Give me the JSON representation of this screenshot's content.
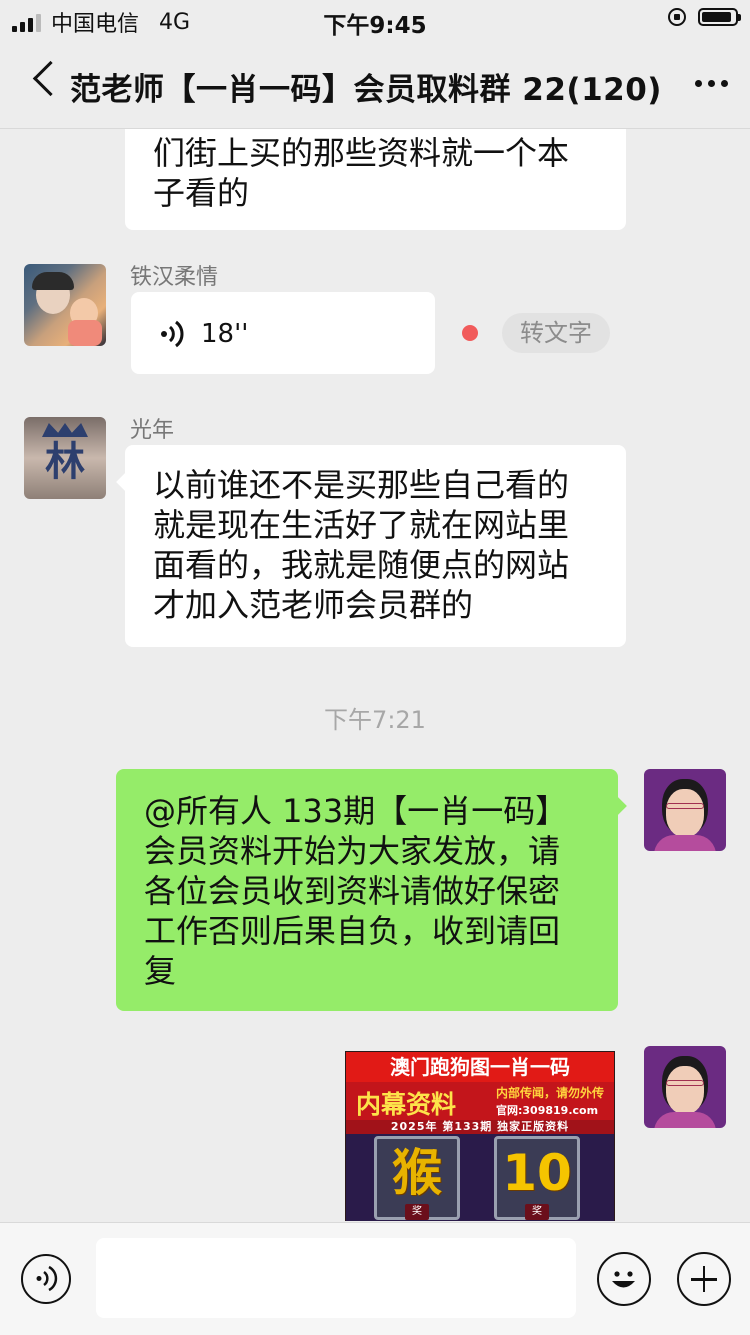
{
  "status_bar": {
    "carrier": "中国电信",
    "network": "4G",
    "time": "下午9:45",
    "battery_level": 0.9
  },
  "nav": {
    "title": "范老师【一肖一码】会员取料群 22(120)",
    "back_icon": "chevron-left-icon",
    "more_icon": "more-dots-icon"
  },
  "messages": {
    "m1_text_line1": "们街上买的那些资料就一个本",
    "m1_text_line2": "子看的",
    "m2_sender": "铁汉柔情",
    "m2_voice_length": "18''",
    "m2_convert_label": "转文字",
    "m3_sender": "光年",
    "m3_lines": [
      "以前谁还不是买那些自己看的",
      "就是现在生活好了就在网站里",
      "面看的，我就是随便点的网站",
      "才加入范老师会员群的"
    ],
    "timestamp": "下午7:21",
    "m4_lines": [
      "@所有人 133期【一肖一码】",
      "会员资料开始为大家发放，请",
      "各位会员收到资料请做好保密",
      "工作否则后果自负，收到请回",
      "复"
    ],
    "promo": {
      "title": "澳门跑狗图一肖一码",
      "big": "内幕资料",
      "side": "内部传闻，请勿外传",
      "site": "官网:309819.com",
      "bar": "2025年 第133期 独家正版资料",
      "badge1": "猴",
      "badge2": "10",
      "badge_tag": "奖"
    }
  },
  "bottom": {
    "voice_icon": "voice-icon",
    "emoji_icon": "emoji-icon",
    "plus_icon": "plus-icon"
  },
  "colors": {
    "background": "#ededed",
    "green_bubble": "#95ec69",
    "red_dot": "#f15b5b"
  }
}
